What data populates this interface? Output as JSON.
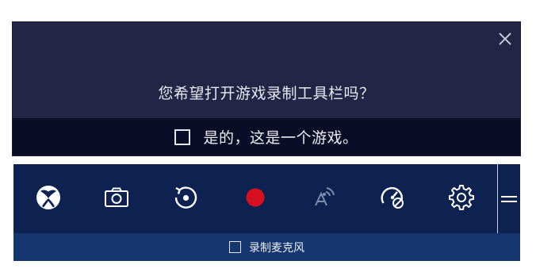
{
  "prompt": {
    "question": "您希望打开游戏录制工具栏吗？",
    "confirm_checkbox_label": "是的，这是一个游戏。",
    "confirm_checked": false,
    "close_icon": "close-icon"
  },
  "gamebar": {
    "buttons": [
      {
        "name": "xbox-button",
        "icon": "xbox-logo-icon"
      },
      {
        "name": "screenshot-button",
        "icon": "camera-icon"
      },
      {
        "name": "record-that-button",
        "icon": "replay-icon"
      },
      {
        "name": "record-button",
        "icon": "record-dot-icon"
      },
      {
        "name": "broadcast-button",
        "icon": "broadcast-icon",
        "disabled": true
      },
      {
        "name": "game-mode-button",
        "icon": "game-mode-icon"
      },
      {
        "name": "settings-button",
        "icon": "gear-icon"
      }
    ],
    "grip_icon": "drag-handle-icon",
    "mic_checkbox_label": "录制麦克风",
    "mic_checked": false
  },
  "colors": {
    "prompt_bg": "#232446",
    "prompt_footer_bg": "#0b0c26",
    "toolbar_bg": "#0d2251",
    "mic_row_bg": "#16366f",
    "record_red": "#d7101f",
    "disabled_icon": "#7c8cab"
  }
}
